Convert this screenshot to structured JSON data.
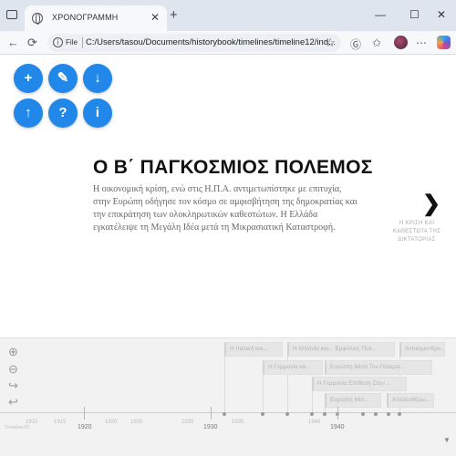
{
  "browser": {
    "tab_title": "ΧΡΟΝΟΓΡΑΜΜΗ",
    "tab_close": "✕",
    "new_tab": "+",
    "controls": {
      "minimize": "—",
      "maximize": "☐",
      "close": "✕"
    },
    "nav": {
      "back": "←",
      "reload": "⟳"
    },
    "address": {
      "file_label": "File",
      "url": "C:/Users/tasou/Documents/historybook/timelines/timeline12/ind..."
    },
    "icons": [
      "star-icon",
      "reload-g-icon",
      "favorites-icon",
      "avatar",
      "more-icon",
      "copilot-icon"
    ]
  },
  "toolbar_buttons": [
    {
      "name": "add-button",
      "glyph": "+"
    },
    {
      "name": "edit-button",
      "glyph": "✎"
    },
    {
      "name": "download-button",
      "glyph": "↓"
    },
    {
      "name": "upload-button",
      "glyph": "↑"
    },
    {
      "name": "help-button",
      "glyph": "?"
    },
    {
      "name": "info-button",
      "glyph": "i"
    }
  ],
  "slide": {
    "headline": "Ο Β΄ ΠΑΓΚΟΣΜΙΟΣ ΠΟΛΕΜΟΣ",
    "text": "Η οικονομική κρίση, ενώ στις Η.Π.Α. αντιμετωπίστηκε με επιτυχία, στην Ευρώπη οδήγησε τον κόσμο σε αμφισβήτηση της δημοκρατίας και την επικράτηση των ολοκληρωτικών καθεστώτων. Η Ελλάδα εγκατέλειψε τη Μεγάλη Ιδέα μετά τη Μικρασιατική Καταστροφή.",
    "next_arrow": "❯",
    "next_label": "Η ΚΡΙΣΗ ΚΑΙ ΚΑΘΕΣΤΩΤΑ ΤΗΣ ΔΙΚΤΑΤΟΡΙΑΣ"
  },
  "timeline": {
    "controls": [
      "zoom-in-icon",
      "zoom-out-icon",
      "return-icon",
      "back-icon"
    ],
    "control_glyphs": {
      "zoom_in": "⊕",
      "zoom_out": "⊖",
      "return": "↪",
      "back": "↩"
    },
    "events": [
      "Η Ιταλική και...",
      "Η Ισπανία και... Εμφύλιος Πολ...",
      "Αντικομιντέρν...",
      "Η Γερμανία κα...",
      "Ευρώπη Μετά Τον Πόλεμο...",
      "Η Γερμανία Επίθεση Στην...",
      "Ευρώπη Μετ...",
      "Απελευθέρω..."
    ],
    "minor_years": [
      "1910",
      "1915",
      "1920",
      "1925",
      "1930",
      "1935",
      "1940"
    ],
    "major_years": [
      "1920",
      "1930",
      "1940"
    ],
    "brand": "TimelineJS",
    "scroll_down": "▼"
  }
}
